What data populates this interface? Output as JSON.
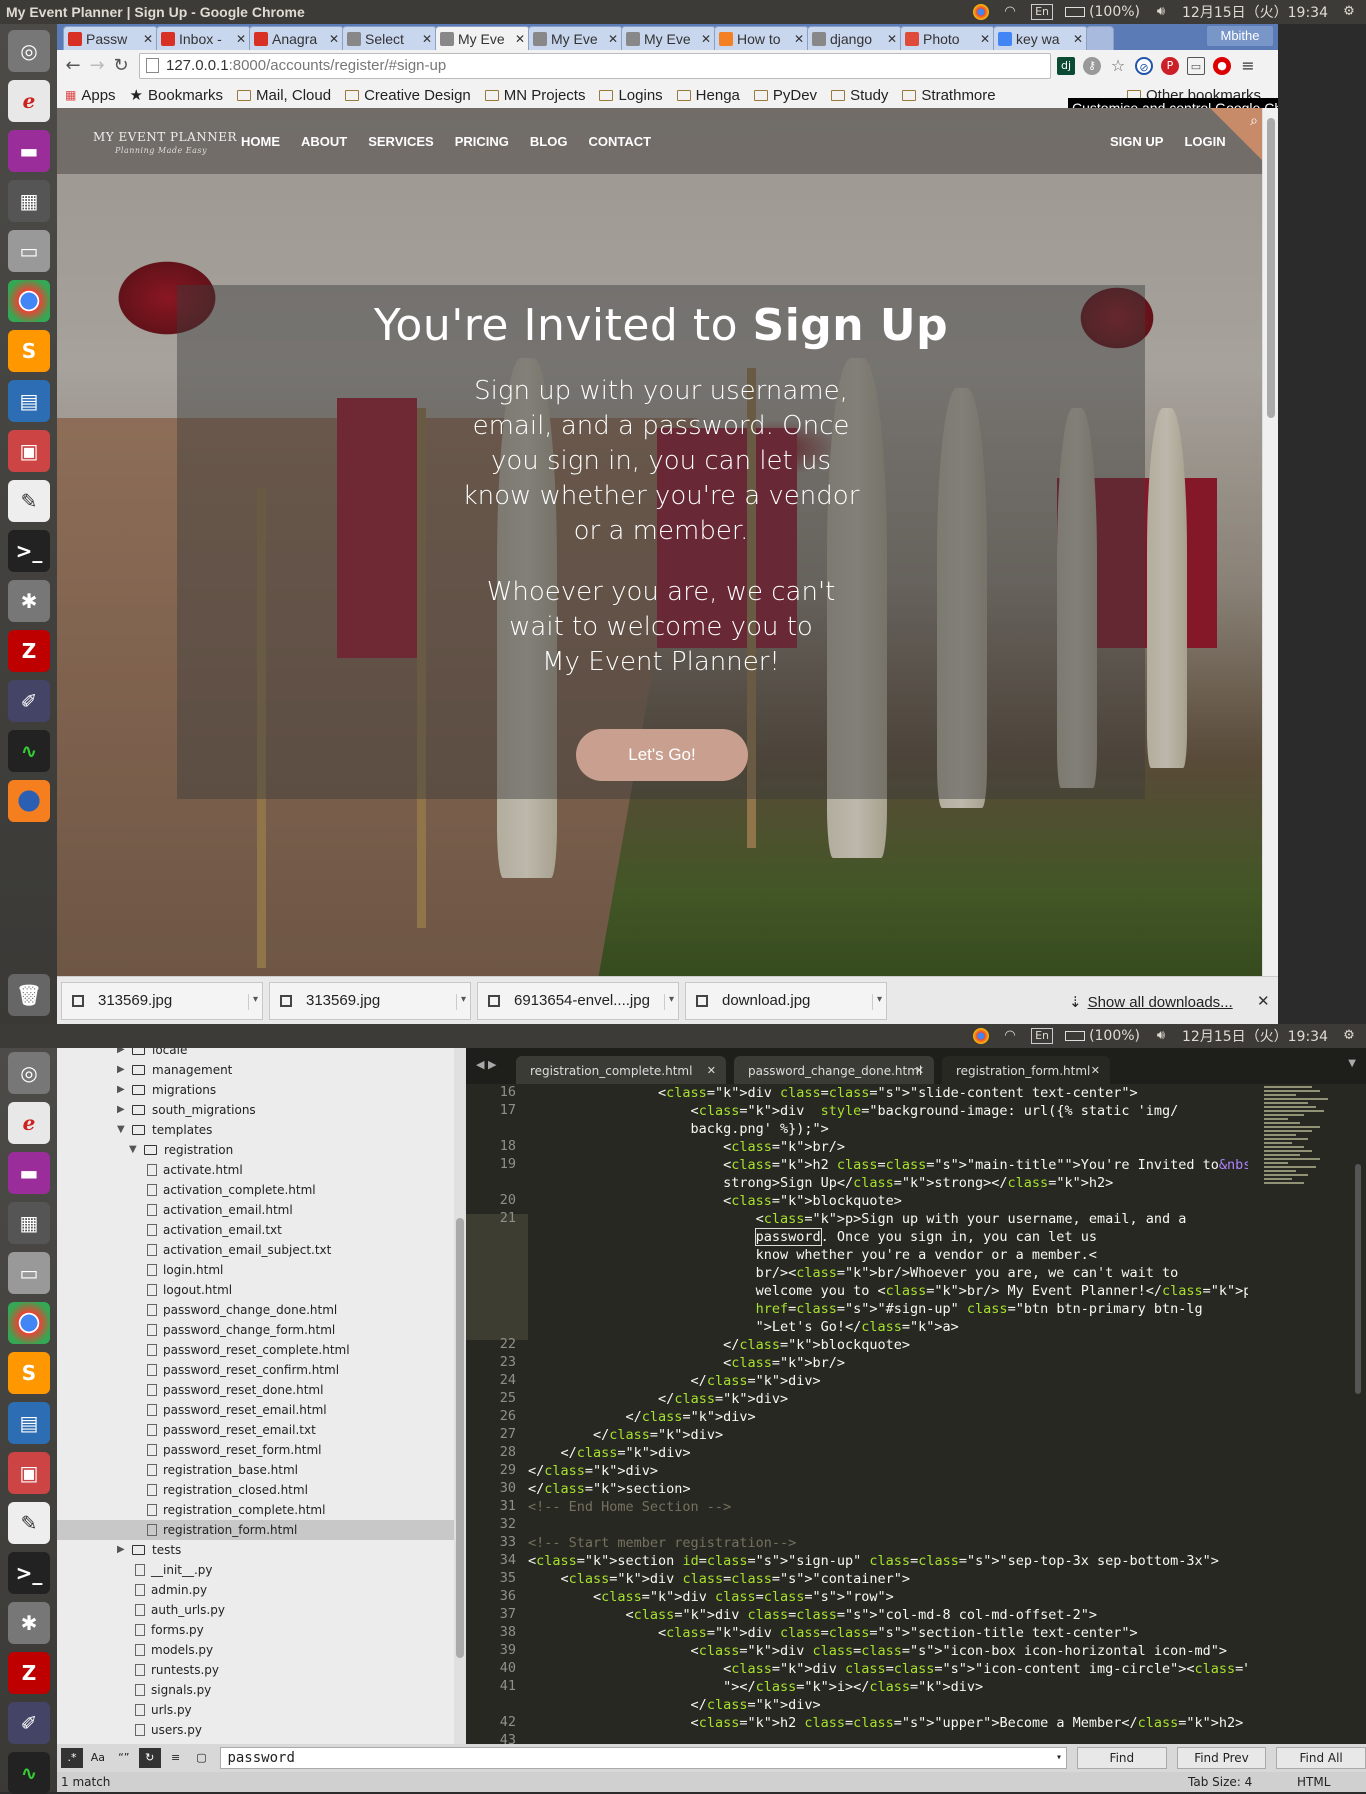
{
  "top_panel": {
    "window_title": "My Event Planner | Sign Up - Google Chrome",
    "keyboard": "En",
    "battery": "(100%)",
    "datetime": "12月15日（火）19:34"
  },
  "bottom_panel": {
    "keyboard": "En",
    "battery": "(100%)",
    "datetime": "12月15日（火）19:34"
  },
  "browser": {
    "tabs": [
      {
        "label": "Passw",
        "color": "#d93025"
      },
      {
        "label": "Inbox -",
        "color": "#d93025"
      },
      {
        "label": "Anagra",
        "color": "#d93025"
      },
      {
        "label": "Select",
        "color": "#888888"
      },
      {
        "label": "My Eve",
        "color": "#888888"
      },
      {
        "label": "My Eve",
        "color": "#888888"
      },
      {
        "label": "My Eve",
        "color": "#888888"
      },
      {
        "label": "How to",
        "color": "#f48024"
      },
      {
        "label": "django",
        "color": "#888888"
      },
      {
        "label": "Photo",
        "color": "#e04a3a"
      },
      {
        "label": "key wa",
        "color": "#4285f4"
      }
    ],
    "profile": "Mbithe",
    "url_host": "127.0.0.1",
    "url_rest": ":8000/accounts/register/#sign-up",
    "bookmarks": [
      "Apps",
      "Bookmarks",
      "Mail, Cloud",
      "Creative Design",
      "MN Projects",
      "Logins",
      "Henga",
      "PyDev",
      "Study",
      "Strathmore"
    ],
    "other_bookmarks": "Other bookmarks",
    "tooltip": "Customise and control Google Chrome",
    "downloads": [
      "313569.jpg",
      "313569.jpg",
      "6913654-envel....jpg",
      "download.jpg"
    ],
    "show_all_downloads": "Show all downloads..."
  },
  "site": {
    "logo_main": "MY EVENT PLANNER",
    "logo_tag": "Planning Made Easy",
    "nav": [
      "HOME",
      "ABOUT",
      "SERVICES",
      "PRICING",
      "BLOG",
      "CONTACT"
    ],
    "nav_right": [
      "SIGN UP",
      "LOGIN"
    ],
    "title_a": "You're Invited to ",
    "title_b": "Sign Up",
    "p1": "Sign up with your username, email, and a password. Once you sign in, you can let us know whether you're a vendor or a member.",
    "p2": "Whoever you are, we can't wait to welcome you to",
    "p3": "My Event Planner!",
    "cta": "Let's Go!"
  },
  "sidebar": {
    "items": [
      {
        "label": "locale",
        "type": "folder",
        "depth": 1,
        "open": false
      },
      {
        "label": "management",
        "type": "folder",
        "depth": 1,
        "open": false
      },
      {
        "label": "migrations",
        "type": "folder",
        "depth": 1,
        "open": false
      },
      {
        "label": "south_migrations",
        "type": "folder",
        "depth": 1,
        "open": false
      },
      {
        "label": "templates",
        "type": "folder",
        "depth": 1,
        "open": true
      },
      {
        "label": "registration",
        "type": "folder",
        "depth": 2,
        "open": true
      },
      {
        "label": "activate.html",
        "type": "file",
        "depth": 3
      },
      {
        "label": "activation_complete.html",
        "type": "file",
        "depth": 3
      },
      {
        "label": "activation_email.html",
        "type": "file",
        "depth": 3
      },
      {
        "label": "activation_email.txt",
        "type": "file",
        "depth": 3
      },
      {
        "label": "activation_email_subject.txt",
        "type": "file",
        "depth": 3
      },
      {
        "label": "login.html",
        "type": "file",
        "depth": 3
      },
      {
        "label": "logout.html",
        "type": "file",
        "depth": 3
      },
      {
        "label": "password_change_done.html",
        "type": "file",
        "depth": 3
      },
      {
        "label": "password_change_form.html",
        "type": "file",
        "depth": 3
      },
      {
        "label": "password_reset_complete.html",
        "type": "file",
        "depth": 3
      },
      {
        "label": "password_reset_confirm.html",
        "type": "file",
        "depth": 3
      },
      {
        "label": "password_reset_done.html",
        "type": "file",
        "depth": 3
      },
      {
        "label": "password_reset_email.html",
        "type": "file",
        "depth": 3
      },
      {
        "label": "password_reset_email.txt",
        "type": "file",
        "depth": 3
      },
      {
        "label": "password_reset_form.html",
        "type": "file",
        "depth": 3
      },
      {
        "label": "registration_base.html",
        "type": "file",
        "depth": 3
      },
      {
        "label": "registration_closed.html",
        "type": "file",
        "depth": 3
      },
      {
        "label": "registration_complete.html",
        "type": "file",
        "depth": 3
      },
      {
        "label": "registration_form.html",
        "type": "file",
        "depth": 3,
        "selected": true
      },
      {
        "label": "tests",
        "type": "folder",
        "depth": 1,
        "open": false
      },
      {
        "label": "__init__.py",
        "type": "file",
        "depth": 1
      },
      {
        "label": "admin.py",
        "type": "file",
        "depth": 1
      },
      {
        "label": "auth_urls.py",
        "type": "file",
        "depth": 1
      },
      {
        "label": "forms.py",
        "type": "file",
        "depth": 1
      },
      {
        "label": "models.py",
        "type": "file",
        "depth": 1
      },
      {
        "label": "runtests.py",
        "type": "file",
        "depth": 1
      },
      {
        "label": "signals.py",
        "type": "file",
        "depth": 1
      },
      {
        "label": "urls.py",
        "type": "file",
        "depth": 1
      },
      {
        "label": "users.py",
        "type": "file",
        "depth": 1
      }
    ]
  },
  "editor": {
    "tabs": [
      "registration_complete.html",
      "password_change_done.html",
      "registration_form.html"
    ],
    "active_tab": 2,
    "line_numbers": [
      "16",
      "17",
      "",
      "18",
      "19",
      "",
      "20",
      "21",
      "",
      "",
      "",
      "",
      "",
      "",
      "22",
      "23",
      "24",
      "25",
      "26",
      "27",
      "28",
      "29",
      "30",
      "31",
      "32",
      "33",
      "34",
      "35",
      "36",
      "37",
      "38",
      "39",
      "40",
      "41",
      "",
      "42",
      "43"
    ],
    "lines": [
      "                <div class=\"slide-content text-center\">",
      "                    <div  style=\"background-image: url({% static 'img/",
      "                    backg.png' %});\">",
      "                        <br/>",
      "                        <h2 class=\"main-title\"\">You're Invited to&nbsp;<",
      "                        strong>Sign Up</strong></h2>",
      "                        <blockquote>",
      "                            <p>Sign up with your username, email, and a",
      "                            password. Once you sign in, you can let us",
      "                            know whether you're a vendor or a member.<",
      "                            br/><br/>Whoever you are, we can't wait to",
      "                            welcome you to <br/> My Event Planner!</p><a",
      "                            href=\"#sign-up\" class=\"btn btn-primary btn-lg",
      "                            \">Let's Go!</a>",
      "                        </blockquote>",
      "                        <br/>",
      "                    </div>",
      "                </div>",
      "            </div>",
      "        </div>",
      "    </div>",
      "</div>",
      "</section>",
      "<!-- End Home Section -->",
      "",
      "<!-- Start member registration-->",
      "<section id=\"sign-up\" class=\"sep-top-3x sep-bottom-3x\">",
      "    <div class=\"container\">",
      "        <div class=\"row\">",
      "            <div class=\"col-md-8 col-md-offset-2\">",
      "                <div class=\"section-title text-center\">",
      "                    <div class=\"icon-box icon-horizontal icon-md\">",
      "                        <div class=\"icon-content img-circle\"><i class=\"fa fa-user",
      "                        \"></i></div>",
      "                    </div>",
      "                    <h2 class=\"upper\">Become a Member</h2>",
      ""
    ]
  },
  "find": {
    "query": "password",
    "find": "Find",
    "find_prev": "Find Prev",
    "find_all": "Find All",
    "matches": "1 match",
    "tab_size": "Tab Size: 4",
    "syntax": "HTML"
  }
}
